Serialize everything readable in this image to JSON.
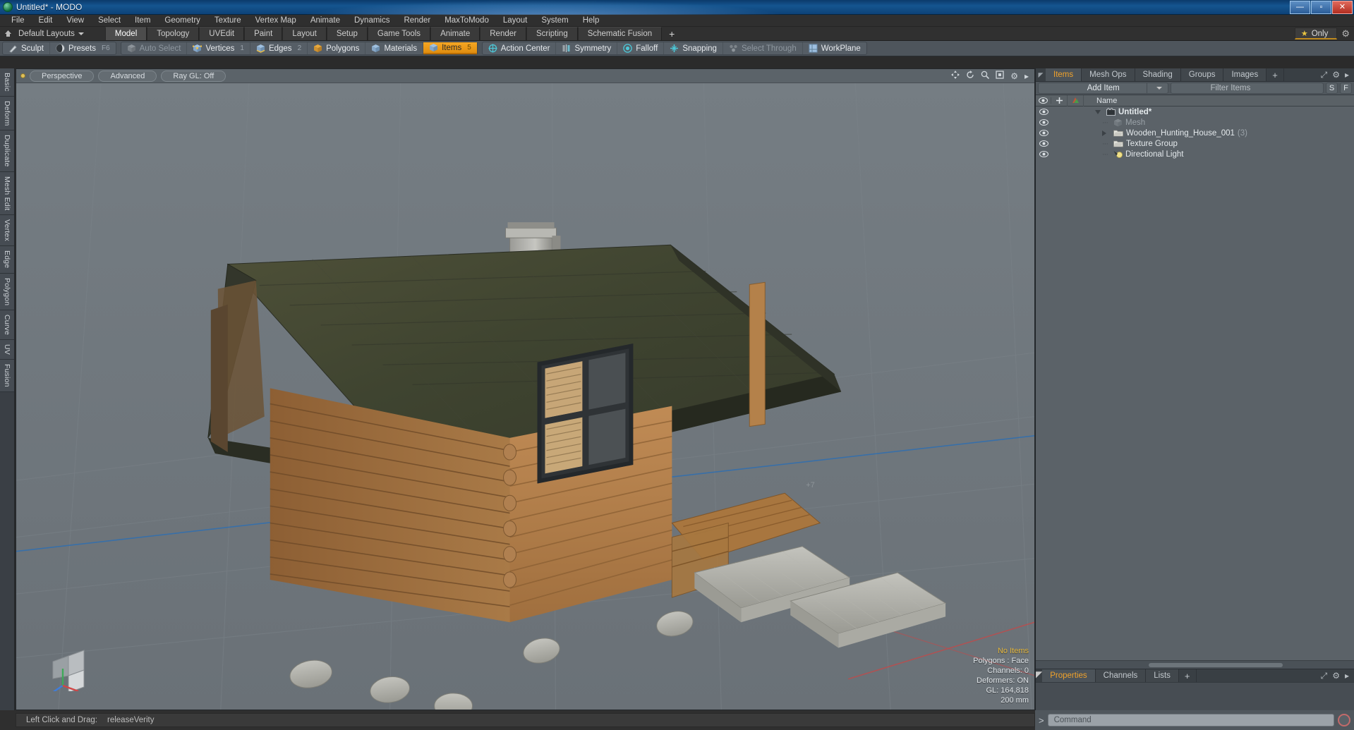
{
  "window": {
    "title": "Untitled* - MODO",
    "app_icon": "modo-logo-icon",
    "minimize_label": "—",
    "maximize_label": "▫",
    "close_label": "✕"
  },
  "menubar": {
    "items": [
      "File",
      "Edit",
      "View",
      "Select",
      "Item",
      "Geometry",
      "Texture",
      "Vertex Map",
      "Animate",
      "Dynamics",
      "Render",
      "MaxToModo",
      "Layout",
      "System",
      "Help"
    ]
  },
  "layoutbar": {
    "home_icon": "home-icon",
    "layout_preset": "Default Layouts",
    "tabs": [
      {
        "label": "Model",
        "active": true
      },
      {
        "label": "Topology",
        "active": false
      },
      {
        "label": "UVEdit",
        "active": false
      },
      {
        "label": "Paint",
        "active": false
      },
      {
        "label": "Layout",
        "active": false
      },
      {
        "label": "Setup",
        "active": false
      },
      {
        "label": "Game Tools",
        "active": false
      },
      {
        "label": "Animate",
        "active": false
      },
      {
        "label": "Render",
        "active": false
      },
      {
        "label": "Scripting",
        "active": false
      },
      {
        "label": "Schematic Fusion",
        "active": false
      }
    ],
    "add_tab_label": "+",
    "only_label": "Only",
    "only_icon": "star-icon",
    "settings_icon": "gear-icon"
  },
  "toolbar": {
    "groups": [
      {
        "buttons": [
          {
            "label": "Sculpt",
            "icon": "brush-icon",
            "state": "normal",
            "shortcut": ""
          },
          {
            "label": "Presets",
            "icon": "sphere-icon",
            "state": "normal",
            "shortcut": "F6"
          }
        ]
      },
      {
        "buttons": [
          {
            "label": "Auto Select",
            "icon": "cube-gray-icon",
            "state": "disabled",
            "shortcut": ""
          },
          {
            "label": "Vertices",
            "icon": "cube-vertex-icon",
            "state": "normal",
            "shortcut": "1"
          },
          {
            "label": "Edges",
            "icon": "cube-edge-icon",
            "state": "normal",
            "shortcut": "2"
          },
          {
            "label": "Polygons",
            "icon": "cube-poly-icon",
            "state": "normal",
            "shortcut": ""
          },
          {
            "label": "Materials",
            "icon": "cube-material-icon",
            "state": "normal",
            "shortcut": ""
          },
          {
            "label": "Items",
            "icon": "cube-items-icon",
            "state": "selected",
            "shortcut": "5"
          }
        ]
      },
      {
        "buttons": [
          {
            "label": "Action Center",
            "icon": "crosshair-circle-icon",
            "state": "normal",
            "shortcut": ""
          },
          {
            "label": "Symmetry",
            "icon": "symmetry-icon",
            "state": "normal",
            "shortcut": ""
          },
          {
            "label": "Falloff",
            "icon": "falloff-target-icon",
            "state": "normal",
            "shortcut": ""
          },
          {
            "label": "Snapping",
            "icon": "snap-cross-icon",
            "state": "normal",
            "shortcut": ""
          },
          {
            "label": "Select Through",
            "icon": "select-through-icon",
            "state": "disabled",
            "shortcut": ""
          },
          {
            "label": "WorkPlane",
            "icon": "workplane-icon",
            "state": "normal",
            "shortcut": ""
          }
        ]
      }
    ]
  },
  "left_tabs": {
    "items": [
      "Basic",
      "Deform",
      "Duplicate",
      "Mesh Edit",
      "Vertex",
      "Edge",
      "Polygon",
      "Curve",
      "UV",
      "Fusion"
    ]
  },
  "viewport": {
    "header": {
      "view_mode": "Perspective",
      "shading_mode": "Advanced",
      "raygl": "Ray GL: Off",
      "icons": [
        "move-view-icon",
        "rotate-view-icon",
        "zoom-view-icon",
        "fit-view-icon",
        "viewport-gear-icon",
        "viewport-expand-icon"
      ]
    },
    "scene_object": "Wooden hunting log cabin with shingled roof, chimney, porch and stone steps",
    "status": {
      "selection": "No Items",
      "mode": "Polygons : Face",
      "channels": "Channels: 0",
      "deformers": "Deformers: ON",
      "gl": "GL: 164,818",
      "grid_size": "200 mm"
    },
    "axis_gizmo": {
      "x": "X",
      "y": "Y",
      "z": "Z"
    }
  },
  "right_panel": {
    "tabs": [
      {
        "label": "Items",
        "active": true
      },
      {
        "label": "Mesh Ops",
        "active": false
      },
      {
        "label": "Shading",
        "active": false
      },
      {
        "label": "Groups",
        "active": false
      },
      {
        "label": "Images",
        "active": false
      }
    ],
    "add_tab_label": "+",
    "header_icons": [
      "expand-icon",
      "gear-icon",
      "chevron-right-icon"
    ],
    "add_item_label": "Add Item",
    "add_item_dropdown_icon": "chevron-down-icon",
    "filter_placeholder": "Filter Items",
    "filter_buttons": [
      "S",
      "F"
    ],
    "columns": {
      "eye": "visibility-icon",
      "lock": "plus-icon",
      "material": "material-icon",
      "name": "Name"
    },
    "items": [
      {
        "name": "Untitled*",
        "icon": "scene-icon",
        "depth": 0,
        "expander": "down",
        "dim": false,
        "count": ""
      },
      {
        "name": "Mesh",
        "icon": "mesh-cube-icon",
        "depth": 1,
        "expander": "none",
        "dim": true,
        "count": ""
      },
      {
        "name": "Wooden_Hunting_House_001",
        "icon": "mesh-folder-icon",
        "depth": 1,
        "expander": "right",
        "dim": false,
        "count": "(3)"
      },
      {
        "name": "Texture Group",
        "icon": "mesh-folder-icon",
        "depth": 1,
        "expander": "none",
        "dim": false,
        "count": ""
      },
      {
        "name": "Directional Light",
        "icon": "light-icon",
        "depth": 1,
        "expander": "none",
        "dim": false,
        "count": ""
      }
    ],
    "bottom_tabs": [
      {
        "label": "Properties",
        "active": true
      },
      {
        "label": "Channels",
        "active": false
      },
      {
        "label": "Lists",
        "active": false
      }
    ],
    "bottom_add_tab_label": "+",
    "bottom_header_icons": [
      "expand-icon",
      "gear-icon",
      "chevron-right-icon"
    ]
  },
  "statusbar": {
    "hint_label": "Left Click and Drag:",
    "hint_value": "releaseVerity",
    "command_prompt": ">",
    "command_placeholder": "Command",
    "record_icon": "record-icon"
  },
  "colors": {
    "accent_orange": "#f0a22b",
    "selected_orange": "#f5a623",
    "star_yellow": "#e8c442",
    "titlebar_blue": "#15558f",
    "panel_gray": "#3d4348",
    "viewport_gray": "#6f777d"
  }
}
